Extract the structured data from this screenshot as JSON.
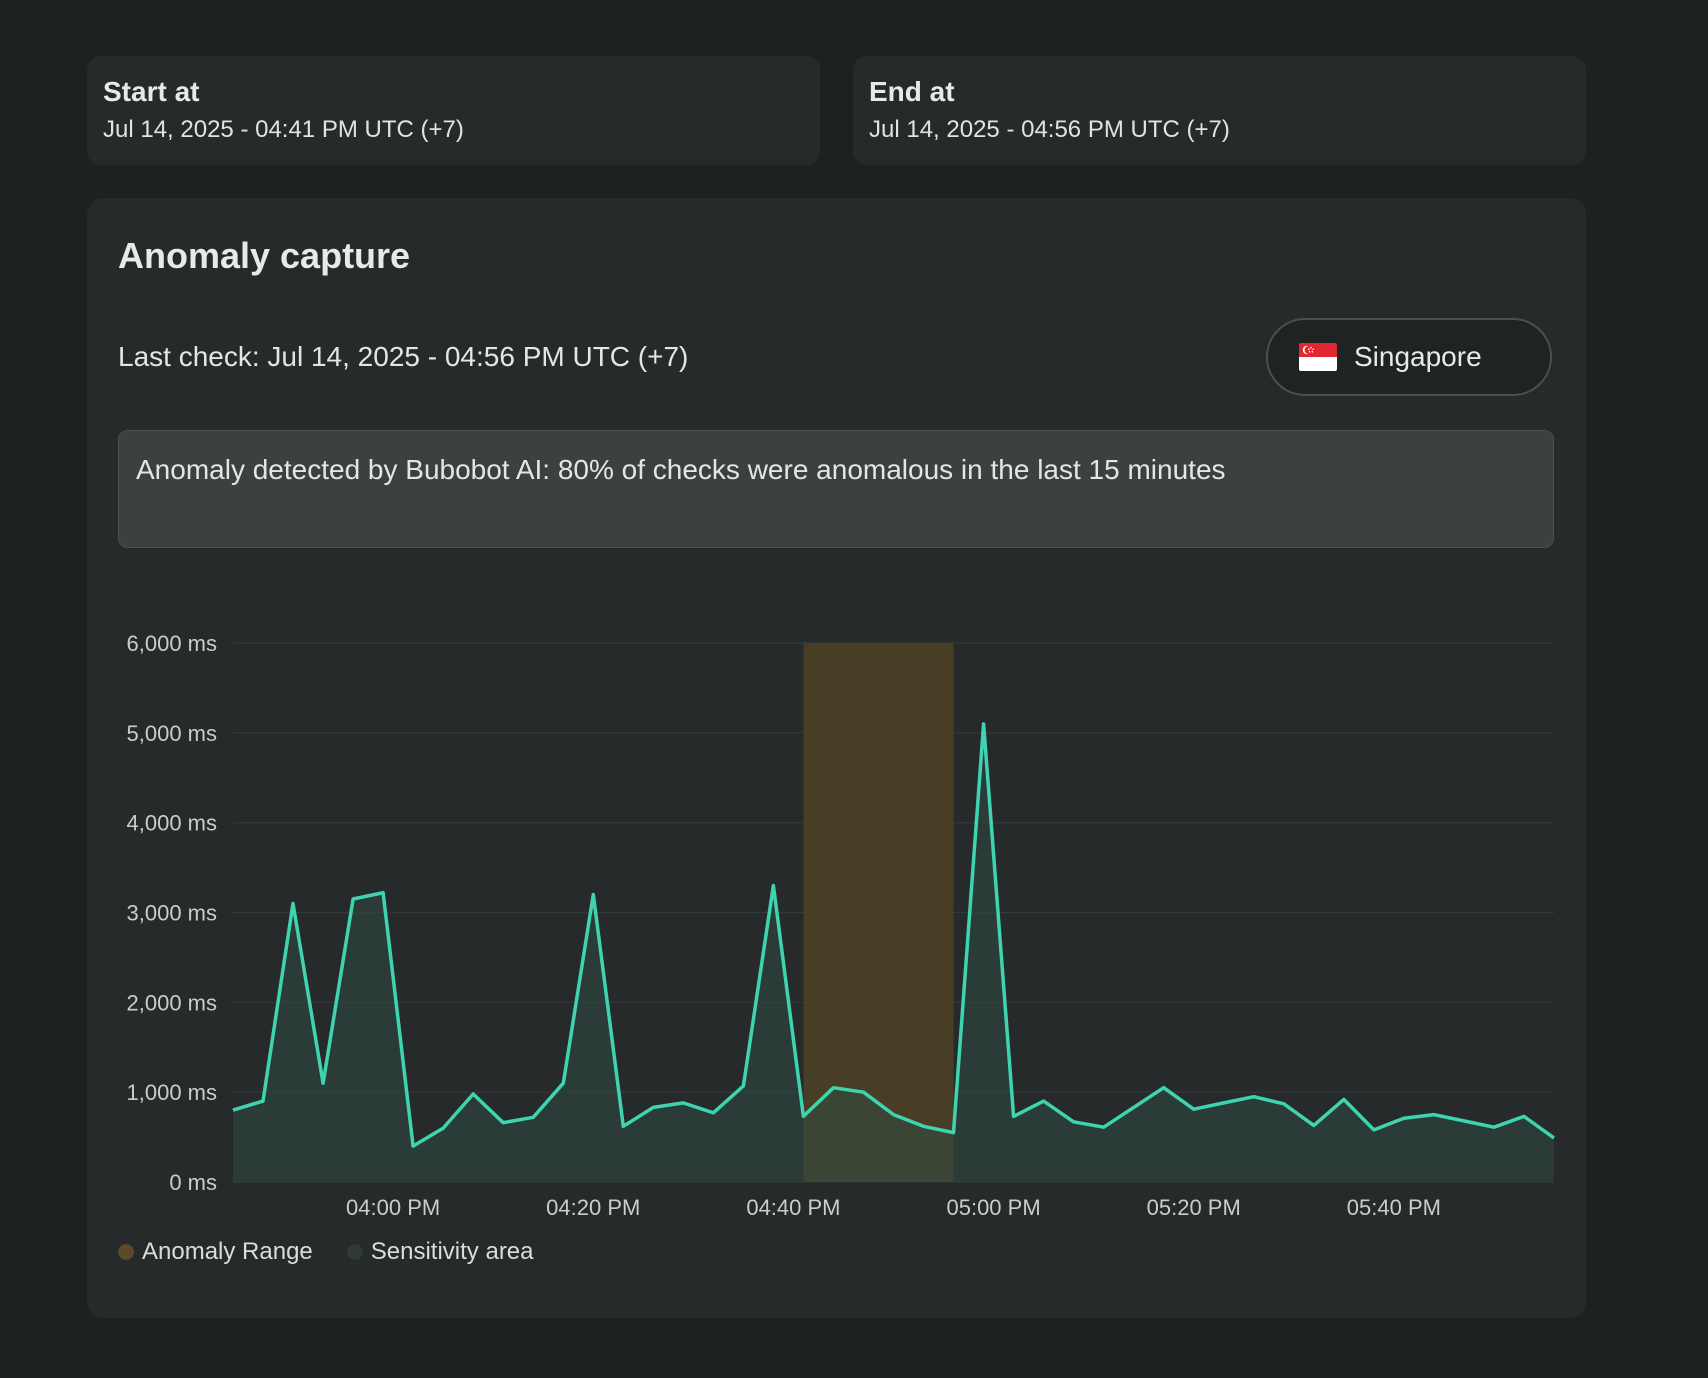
{
  "start": {
    "label": "Start at",
    "value": "Jul 14, 2025 - 04:41 PM UTC (+7)"
  },
  "end": {
    "label": "End at",
    "value": "Jul 14, 2025 - 04:56 PM UTC (+7)"
  },
  "panel": {
    "title": "Anomaly capture",
    "last_check": "Last check: Jul 14, 2025 - 04:56 PM UTC (+7)",
    "location": {
      "label": "Singapore",
      "flag_icon": "singapore-flag-icon"
    },
    "alert": "Anomaly detected by Bubobot AI: 80% of checks were anomalous in the last 15 minutes"
  },
  "colors": {
    "line": "#3fd4b0",
    "area": "#2f4a44",
    "anomaly": "#4a3f25",
    "anomaly_legend": "#5a4a2a",
    "sensitivity_legend": "#2d3a37",
    "grid": "#343939"
  },
  "legend": [
    {
      "label": "Anomaly Range",
      "color": "#5a4a2a"
    },
    {
      "label": "Sensitivity area",
      "color": "#2d3a37"
    }
  ],
  "chart_data": {
    "type": "area",
    "x_unit": "minutes from 03:44 PM",
    "ylim": [
      0,
      6000
    ],
    "yticks": [
      {
        "value": 0,
        "label": "0 ms"
      },
      {
        "value": 1000,
        "label": "1,000 ms"
      },
      {
        "value": 2000,
        "label": "2,000 ms"
      },
      {
        "value": 3000,
        "label": "3,000 ms"
      },
      {
        "value": 4000,
        "label": "4,000 ms"
      },
      {
        "value": 5000,
        "label": "5,000 ms"
      },
      {
        "value": 6000,
        "label": "6,000 ms"
      }
    ],
    "xticks": [
      "04:00 PM",
      "04:20 PM",
      "04:40 PM",
      "05:00 PM",
      "05:20 PM",
      "05:40 PM"
    ],
    "anomaly_range": [
      "04:41 PM",
      "04:56 PM"
    ],
    "series": [
      {
        "values": [
          [
            "03:44 PM",
            800
          ],
          [
            "03:47 PM",
            900
          ],
          [
            "03:50 PM",
            3100
          ],
          [
            "03:53 PM",
            1100
          ],
          [
            "03:56 PM",
            3150
          ],
          [
            "03:59 PM",
            3220
          ],
          [
            "04:02 PM",
            400
          ],
          [
            "04:05 PM",
            600
          ],
          [
            "04:08 PM",
            980
          ],
          [
            "04:11 PM",
            660
          ],
          [
            "04:14 PM",
            720
          ],
          [
            "04:17 PM",
            1100
          ],
          [
            "04:20 PM",
            3200
          ],
          [
            "04:23 PM",
            620
          ],
          [
            "04:26 PM",
            830
          ],
          [
            "04:29 PM",
            880
          ],
          [
            "04:32 PM",
            770
          ],
          [
            "04:35 PM",
            1070
          ],
          [
            "04:38 PM",
            3300
          ],
          [
            "04:41 PM",
            730
          ],
          [
            "04:44 PM",
            1050
          ],
          [
            "04:47 PM",
            1000
          ],
          [
            "04:50 PM",
            750
          ],
          [
            "04:53 PM",
            620
          ],
          [
            "04:56 PM",
            550
          ],
          [
            "04:59 PM",
            5100
          ],
          [
            "05:02 PM",
            730
          ],
          [
            "05:05 PM",
            900
          ],
          [
            "05:08 PM",
            670
          ],
          [
            "05:11 PM",
            610
          ],
          [
            "05:14 PM",
            830
          ],
          [
            "05:17 PM",
            1050
          ],
          [
            "05:20 PM",
            810
          ],
          [
            "05:23 PM",
            880
          ],
          [
            "05:26 PM",
            950
          ],
          [
            "05:29 PM",
            870
          ],
          [
            "05:32 PM",
            630
          ],
          [
            "05:35 PM",
            920
          ],
          [
            "05:38 PM",
            580
          ],
          [
            "05:41 PM",
            710
          ],
          [
            "05:44 PM",
            750
          ],
          [
            "05:47 PM",
            680
          ],
          [
            "05:50 PM",
            610
          ],
          [
            "05:53 PM",
            730
          ],
          [
            "05:56 PM",
            490
          ]
        ]
      }
    ],
    "legend_position": "bottom-left",
    "grid": true
  }
}
